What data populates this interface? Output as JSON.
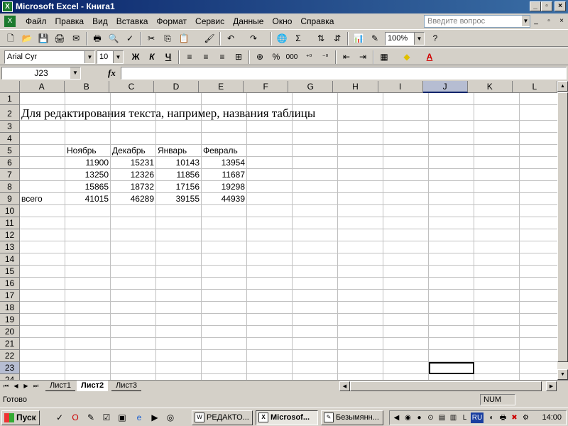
{
  "window": {
    "app_title": "Microsoft Excel - Книга1",
    "app_icon": "excel-icon"
  },
  "menu": {
    "items": [
      "Файл",
      "Правка",
      "Вид",
      "Вставка",
      "Формат",
      "Сервис",
      "Данные",
      "Окно",
      "Справка"
    ],
    "ask_placeholder": "Введите вопрос"
  },
  "toolbar": {
    "zoom": "100%",
    "font_name": "Arial Cyr",
    "font_size": "10",
    "bold_label": "Ж",
    "italic_label": "К",
    "underline_label": "Ч",
    "sum_label": "Σ",
    "percent_label": "%",
    "thousands_label": "000"
  },
  "formula_bar": {
    "name_box": "J23",
    "fx_label": "fx",
    "formula": ""
  },
  "grid": {
    "columns": [
      "A",
      "B",
      "C",
      "D",
      "E",
      "F",
      "G",
      "H",
      "I",
      "J",
      "K",
      "L"
    ],
    "active_column": "J",
    "active_row": 23,
    "row_numbers": [
      "1",
      "2",
      "3",
      "4",
      "5",
      "6",
      "7",
      "8",
      "9",
      "10",
      "11",
      "12",
      "13",
      "14",
      "15",
      "16",
      "17",
      "18",
      "19",
      "20",
      "21",
      "22",
      "23",
      "24"
    ],
    "title_text": "Для редактирования текста, например, названия таблицы",
    "headers": [
      "Ноябрь",
      "Декабрь",
      "Январь",
      "Февраль"
    ],
    "data_rows": [
      {
        "label": "",
        "values": [
          "11900",
          "15231",
          "10143",
          "13954"
        ]
      },
      {
        "label": "",
        "values": [
          "13250",
          "12326",
          "11856",
          "11687"
        ]
      },
      {
        "label": "",
        "values": [
          "15865",
          "18732",
          "17156",
          "19298"
        ]
      },
      {
        "label": "всего",
        "values": [
          "41015",
          "46289",
          "39155",
          "44939"
        ]
      }
    ]
  },
  "sheets": {
    "tabs": [
      "Лист1",
      "Лист2",
      "Лист3"
    ],
    "active": "Лист2"
  },
  "status": {
    "text": "Готово",
    "num_indicator": "NUM"
  },
  "taskbar": {
    "start_label": "Пуск",
    "tasks": [
      {
        "label": "РЕДАКТО...",
        "icon": "word-icon",
        "active": false
      },
      {
        "label": "Microsof...",
        "icon": "excel-icon",
        "active": true
      },
      {
        "label": "Безымянн...",
        "icon": "paint-icon",
        "active": false
      }
    ],
    "tray_lang": "RU",
    "clock": "14:00"
  }
}
